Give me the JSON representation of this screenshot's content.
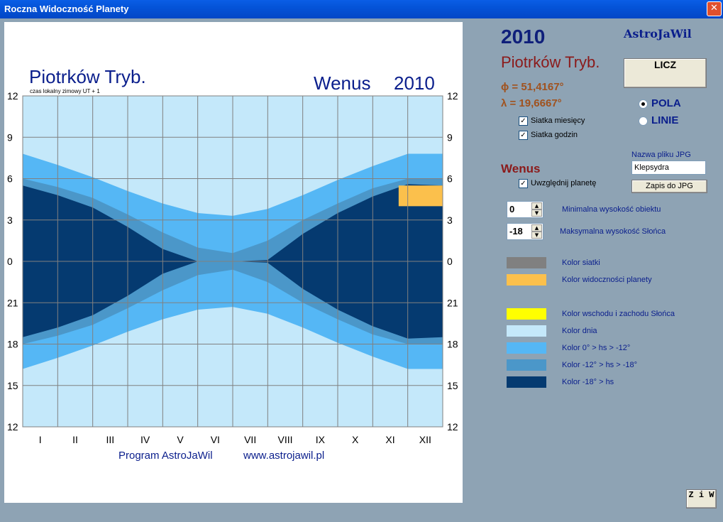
{
  "window": {
    "title": "Roczna Widoczność Planety",
    "close_symbol": "✕"
  },
  "chart": {
    "place": "Piotrków Tryb.",
    "time_note": "czas lokalny zimowy   UT + 1",
    "planet": "Wenus",
    "year": "2010",
    "footer_program": "Program  AstroJaWil",
    "footer_url": "www.astrojawil.pl",
    "hour_ticks": [
      "12",
      "9",
      "6",
      "3",
      "0",
      "21",
      "18",
      "15",
      "12"
    ],
    "month_ticks": [
      "I",
      "II",
      "III",
      "IV",
      "V",
      "VI",
      "VII",
      "VIII",
      "IX",
      "X",
      "XI",
      "XII"
    ]
  },
  "chart_data": {
    "type": "heatmap",
    "title": "Wenus 2010",
    "x_categories": [
      "I",
      "II",
      "III",
      "IV",
      "V",
      "VI",
      "VII",
      "VIII",
      "IX",
      "X",
      "XI",
      "XII"
    ],
    "y_axis_hours": [
      "12",
      "9",
      "6",
      "3",
      "0",
      "21",
      "18",
      "15",
      "12"
    ],
    "y_unit": "hours (noon at top and bottom)",
    "legend": [
      {
        "name": "Kolor siatki",
        "color": "#808080"
      },
      {
        "name": "Kolor widoczności planety",
        "color": "#fbc04c"
      },
      {
        "name": "Kolor wschodu i zachodu Słońca",
        "color": "#ffff00"
      },
      {
        "name": "Kolor dnia",
        "color": "#c4e8fa"
      },
      {
        "name": "Kolor  0° > hs > -12°",
        "color": "#55b7f5"
      },
      {
        "name": "Kolor  -12° > hs > -18°",
        "color": "#4b97c9"
      },
      {
        "name": "Kolor  -18° > hs",
        "color": "#053a70"
      }
    ],
    "bands": {
      "months_fraction": [
        0.0,
        0.083,
        0.167,
        0.25,
        0.333,
        0.417,
        0.5,
        0.583,
        0.667,
        0.75,
        0.833,
        0.917,
        1.0
      ],
      "sunset_hours": [
        16.2,
        17.0,
        17.9,
        18.9,
        19.8,
        20.5,
        20.7,
        20.2,
        19.2,
        18.1,
        17.1,
        16.2,
        16.2
      ],
      "civil_dusk_hours": [
        18.0,
        18.6,
        19.4,
        20.6,
        21.9,
        23.0,
        23.4,
        22.5,
        21.0,
        19.8,
        18.7,
        18.0,
        18.0
      ],
      "astro_dusk_hours": [
        18.5,
        19.2,
        20.1,
        21.5,
        23.1,
        24.0,
        24.0,
        23.9,
        22.0,
        20.5,
        19.3,
        18.4,
        18.5
      ],
      "planet_visibility": {
        "start_month_fraction": 0.895,
        "end_month_fraction": 1.0,
        "from_hour": 4.0,
        "to_hour": 5.5
      }
    }
  },
  "side": {
    "year": "2010",
    "brand": "AstroJaWil",
    "place": "Piotrków Tryb.",
    "phi": "ϕ = 51,4167°",
    "lambda": "λ = 19,6667°",
    "compute_button": "LICZ",
    "radio_fields": "POLA",
    "radio_lines": "LINIE",
    "check_month_grid": "Siatka miesięcy",
    "check_hour_grid": "Siatka godzin",
    "jpg_label": "Nazwa pliku JPG",
    "jpg_value": "Klepsydra",
    "save_button": "Zapis do JPG",
    "planet_heading": "Wenus",
    "check_include_planet": "Uwzględnij planetę",
    "min_height_value": "0",
    "min_height_label": "Minimalna wysokość obiektu",
    "max_sun_value": "-18",
    "max_sun_label": "Maksymalna wysokość Słońca",
    "ziw_button": "Z i W"
  },
  "colors": {
    "grid": "#808080",
    "planet": "#fbc04c",
    "sun_rise_set": "#ffff00",
    "day": "#c4e8fa",
    "twilight1": "#55b7f5",
    "twilight2": "#4b97c9",
    "night": "#053a70",
    "dark_blue_text": "#0a1e8c",
    "brown_text": "#8b1a1a"
  }
}
